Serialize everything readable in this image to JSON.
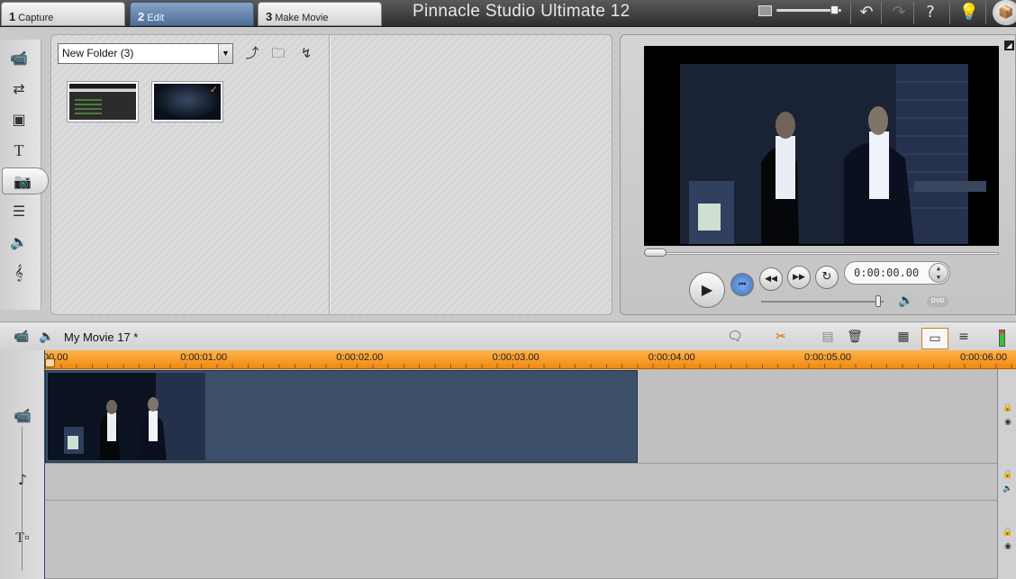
{
  "tabs": [
    {
      "num": "1",
      "label": "Capture"
    },
    {
      "num": "2",
      "label": "Edit"
    },
    {
      "num": "3",
      "label": "Make Movie"
    }
  ],
  "app_title": "Pinnacle Studio Ultimate 12",
  "top_icons": [
    "screen-mode-icon",
    "undo-icon",
    "redo-icon",
    "help-icon",
    "tip-bulb-icon",
    "premium-pack-icon"
  ],
  "zoom_level_fraction": 0.95,
  "album": {
    "folder_select": "New Folder (3)",
    "buttons": [
      "parent-folder-icon",
      "open-folder-icon",
      "scene-detect-icon"
    ],
    "thumbnails": [
      {
        "name": "screenshot-thumbnail",
        "checked": false
      },
      {
        "name": "movie-scene-thumbnail",
        "checked": true
      }
    ]
  },
  "categories": [
    "video-clips-icon",
    "transitions-icon",
    "themes-icon",
    "titles-icon",
    "photos-icon",
    "disc-menus-icon",
    "sound-effects-icon",
    "music-icon"
  ],
  "active_category": "photos-icon",
  "preview": {
    "timecode": "0:00:00.00",
    "scrub_fraction": 0.0,
    "volume_fraction": 0.98,
    "dvd_label": "DVD"
  },
  "timeline": {
    "movie_title": "My Movie 17 *",
    "ruler_labels": [
      "00.00",
      "0:00:01.00",
      "0:00:02.00",
      "0:00:03.00",
      "0:00:04.00",
      "0:00:05.00",
      "0:00:06.00"
    ],
    "clip_duration_seconds": 3.8,
    "total_visible_seconds": 6.0
  }
}
